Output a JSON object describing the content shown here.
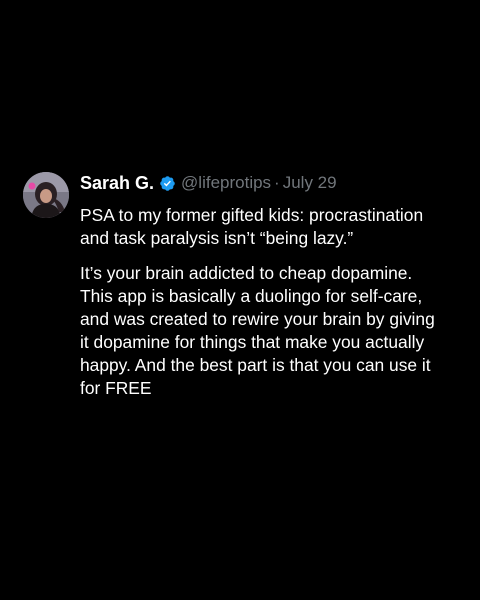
{
  "tweet": {
    "author": {
      "name": "Sarah G.",
      "handle": "@lifeprotips",
      "verified": true,
      "avatar_icon": "profile-photo"
    },
    "separator": "·",
    "date": "July 29",
    "paragraphs": [
      "PSA to my former gifted kids: procrastination\nand task paralysis isn’t “being lazy.”",
      "It’s your brain addicted to cheap dopamine.\nThis app is basically a duolingo for self-care,\nand was created to rewire your brain by giving\nit dopamine for things that make you actually\nhappy.  And the best part is that you can use it\nfor FREE"
    ]
  },
  "colors": {
    "background": "#000000",
    "text": "#ffffff",
    "muted": "#71767b",
    "verified_badge": "#1d9bf0"
  }
}
